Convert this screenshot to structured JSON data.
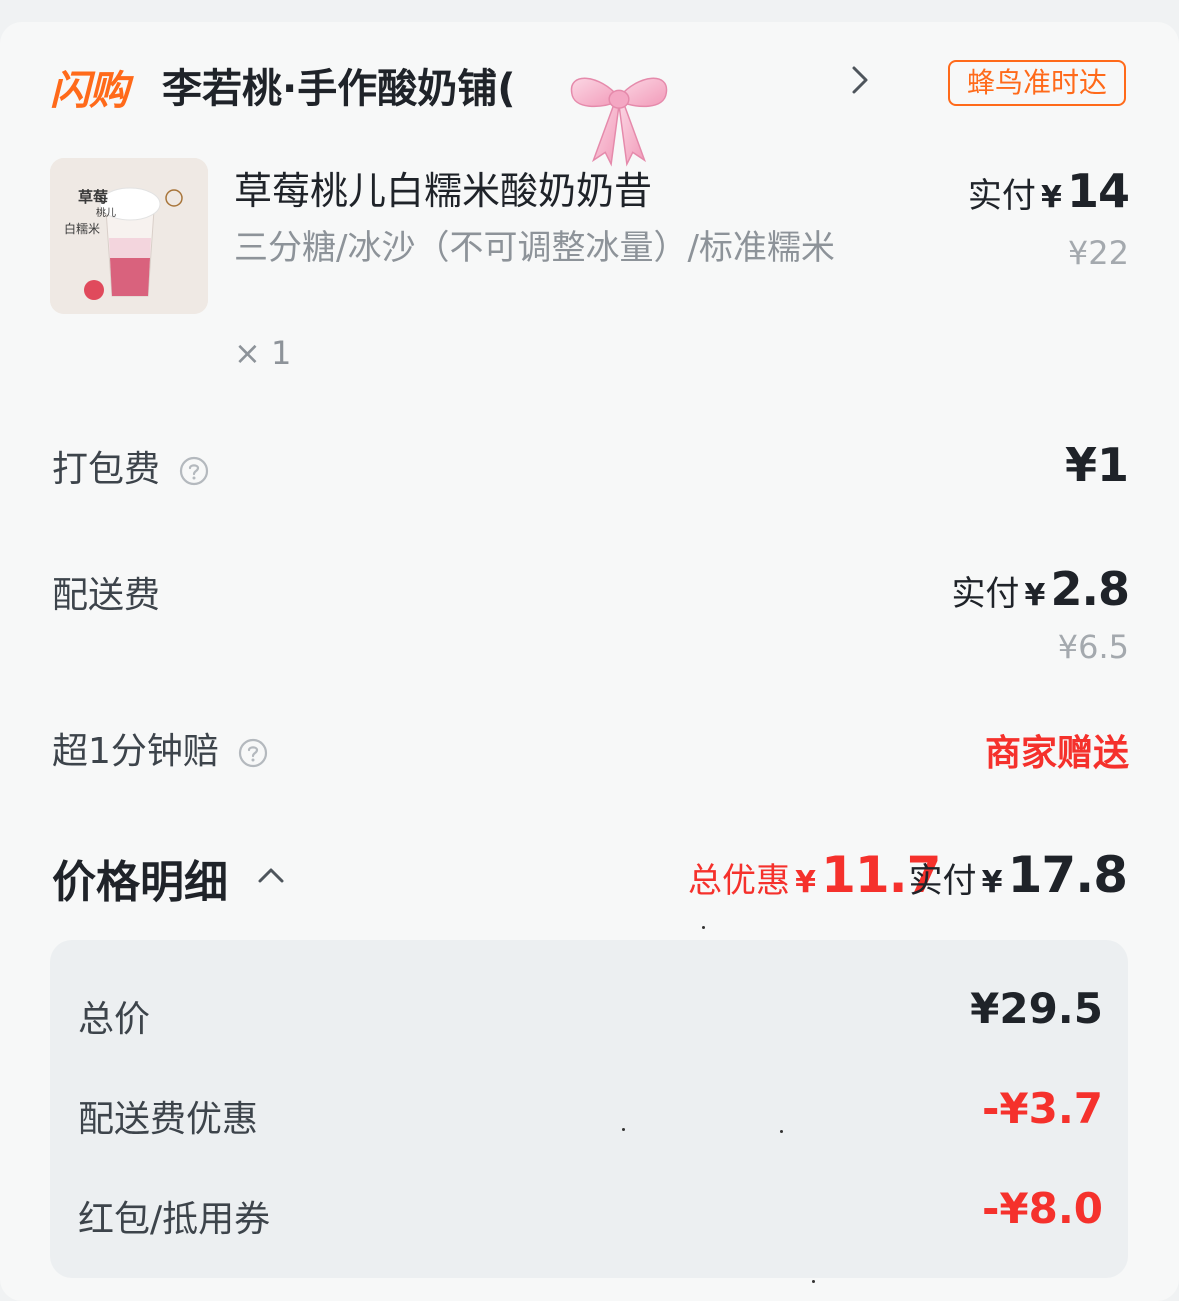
{
  "header": {
    "brand": "闪购",
    "shop_name": "李若桃·手作酸奶铺(",
    "delivery_badge": "蜂鸟准时达"
  },
  "product": {
    "name": "草莓桃儿白糯米酸奶奶昔",
    "spec": "三分糖/冰沙（不可调整冰量）/标准糯米",
    "qty": "× 1",
    "pay_label": "实付",
    "pay_currency": "¥",
    "pay_amount": "14",
    "original_price": "¥22",
    "thumb_text": {
      "line1": "草莓",
      "line2": "桃儿",
      "line3": "白糯米"
    }
  },
  "fees": {
    "packing": {
      "label": "打包费",
      "value": "¥1"
    },
    "delivery": {
      "label": "配送费",
      "pay_label": "实付",
      "pay_currency": "¥",
      "pay_amount": "2.8",
      "original": "¥6.5"
    },
    "late_comp": {
      "label": "超1分钟赔",
      "value": "商家赠送"
    }
  },
  "summary": {
    "title": "价格明细",
    "discount_label": "总优惠",
    "discount_currency": "¥",
    "discount_amount": "11.7",
    "pay_label": "实付",
    "pay_currency": "¥",
    "pay_amount": "17.8"
  },
  "breakdown": [
    {
      "label": "总价",
      "value": "¥29.5"
    },
    {
      "label": "配送费优惠",
      "value": "-¥3.7"
    },
    {
      "label": "红包/抵用券",
      "value": "-¥8.0"
    }
  ],
  "colors": {
    "accent_orange": "#ff6a1a",
    "discount_red": "#f5312c",
    "text_primary": "#1f2329",
    "text_secondary": "#8d9399"
  },
  "icons": {
    "chevron": "chevron-right-icon",
    "help": "question-circle-icon",
    "caret": "chevron-up-icon",
    "bow": "pink-bow-sticker"
  }
}
